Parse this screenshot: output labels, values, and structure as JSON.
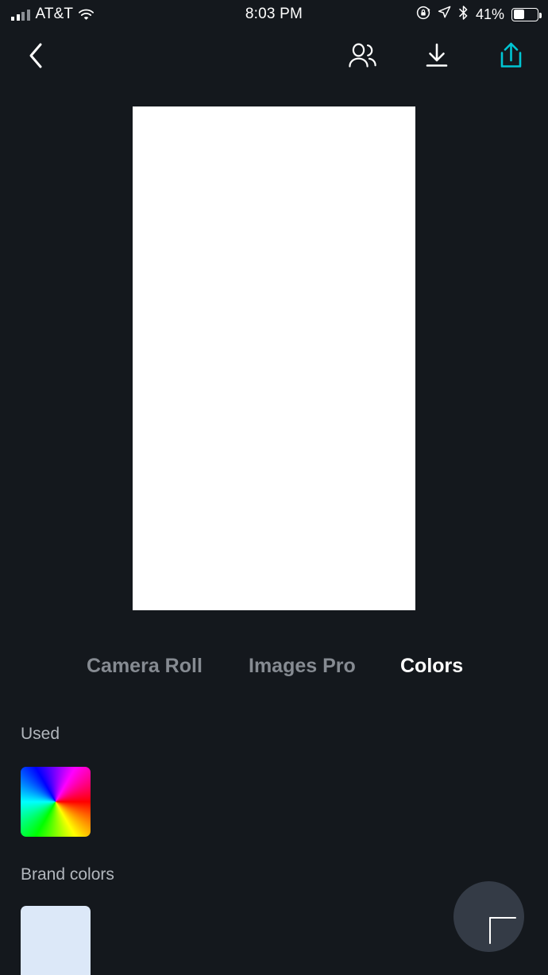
{
  "status_bar": {
    "carrier": "AT&T",
    "time": "8:03 PM",
    "battery_percent": "41%",
    "battery_level": 41,
    "icons": [
      "signal-bars-icon",
      "wifi-icon",
      "rotation-lock-icon",
      "location-arrow-icon",
      "bluetooth-icon",
      "battery-icon"
    ]
  },
  "toolbar": {
    "back_icon": "chevron-left-icon",
    "people_icon": "people-icon",
    "download_icon": "download-icon",
    "share_icon": "share-upload-icon",
    "share_color": "#00c6d4"
  },
  "canvas": {
    "background": "#ffffff"
  },
  "tabs": [
    {
      "label": "Camera Roll",
      "active": false
    },
    {
      "label": "Images Pro",
      "active": false
    },
    {
      "label": "Colors",
      "active": true
    }
  ],
  "sections": {
    "used": {
      "label": "Used",
      "swatches": [
        {
          "name": "color-wheel-swatch",
          "type": "rainbow-wheel"
        }
      ]
    },
    "brand": {
      "label": "Brand colors",
      "swatches": [
        {
          "name": "brand-color-swatch",
          "color": "#dce8f8"
        }
      ]
    }
  },
  "fab": {
    "icon": "plus-icon",
    "background": "#343b46"
  },
  "theme": {
    "background": "#14181d",
    "text_primary": "#ffffff",
    "text_secondary": "#868b92",
    "accent": "#00c6d4"
  }
}
